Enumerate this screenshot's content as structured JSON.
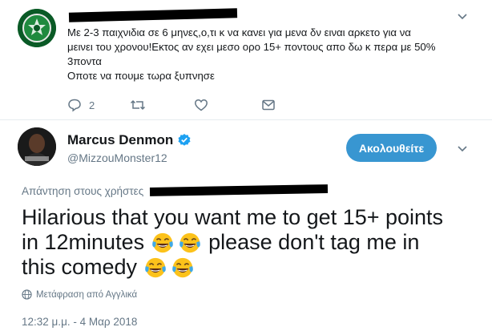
{
  "reply_tweet": {
    "lines": [
      "Με 2-3 παιχνιδια σε 6 μηνες,ο,τι κ να κανει για μενα δν ειναι αρκετο για να",
      "μεινει του χρονου!Εκτος αν εχει μεσο ορο 15+ ποντους απο δω κ περα με 50%",
      "3ποντα",
      "Οποτε να πουμε τωρα ξυπνησε"
    ],
    "reply_count": "2",
    "icons": [
      "reply-icon",
      "retweet-icon",
      "like-icon",
      "message-icon",
      "chevron-down-icon"
    ]
  },
  "main_tweet": {
    "name": "Marcus Denmon",
    "handle": "@MizzouMonster12",
    "verified": true,
    "follow_label": "Ακολουθείτε",
    "replying_label": "Απάντηση στους χρήστες",
    "body_lines": [
      "Hilarious that you want me to get 15+ points",
      "in 12minutes",
      "please don't tag me in",
      "this comedy"
    ],
    "emoji": "face-with-tears-of-joy",
    "translate_label": "Μετάφραση από Αγγλικά",
    "timestamp": "12:32 μ.μ. - 4 Μαρ 2018"
  },
  "colors": {
    "accent": "#1da1f2",
    "follow_button": "#3896d1",
    "muted_text": "#657786",
    "redaction": "#000000"
  }
}
